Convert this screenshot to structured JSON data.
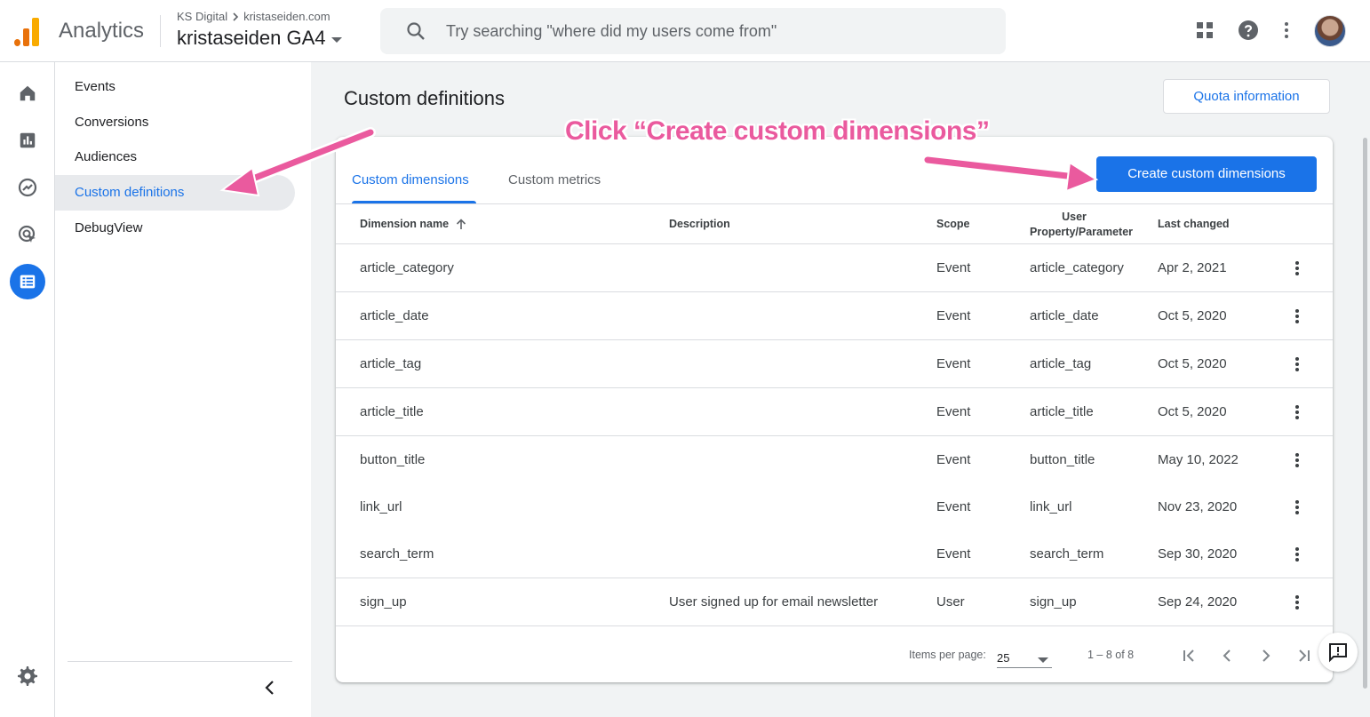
{
  "header": {
    "app_name": "Analytics",
    "account": "KS Digital",
    "site": "kristaseiden.com",
    "property": "kristaseiden GA4",
    "search_placeholder": "Try searching \"where did my users come from\""
  },
  "subnav": {
    "items": [
      {
        "label": "Events"
      },
      {
        "label": "Conversions"
      },
      {
        "label": "Audiences"
      },
      {
        "label": "Custom definitions",
        "active": true
      },
      {
        "label": "DebugView"
      }
    ]
  },
  "page": {
    "title": "Custom definitions",
    "quota_button": "Quota information"
  },
  "tabs": [
    {
      "label": "Custom dimensions",
      "active": true
    },
    {
      "label": "Custom metrics"
    }
  ],
  "create_button": "Create custom dimensions",
  "table": {
    "columns": {
      "name": "Dimension name",
      "description": "Description",
      "scope": "Scope",
      "param_line1": "User",
      "param_line2": "Property/Parameter",
      "changed": "Last changed"
    },
    "rows": [
      {
        "name": "article_category",
        "description": "",
        "scope": "Event",
        "param": "article_category",
        "changed": "Apr 2, 2021"
      },
      {
        "name": "article_date",
        "description": "",
        "scope": "Event",
        "param": "article_date",
        "changed": "Oct 5, 2020"
      },
      {
        "name": "article_tag",
        "description": "",
        "scope": "Event",
        "param": "article_tag",
        "changed": "Oct 5, 2020"
      },
      {
        "name": "article_title",
        "description": "",
        "scope": "Event",
        "param": "article_title",
        "changed": "Oct 5, 2020"
      },
      {
        "name": "button_title",
        "description": "",
        "scope": "Event",
        "param": "button_title",
        "changed": "May 10, 2022"
      },
      {
        "name": "link_url",
        "description": "",
        "scope": "Event",
        "param": "link_url",
        "changed": "Nov 23, 2020"
      },
      {
        "name": "search_term",
        "description": "",
        "scope": "Event",
        "param": "search_term",
        "changed": "Sep 30, 2020"
      },
      {
        "name": "sign_up",
        "description": "User signed up for email newsletter",
        "scope": "User",
        "param": "sign_up",
        "changed": "Sep 24, 2020"
      }
    ]
  },
  "pager": {
    "items_label": "Items per page:",
    "items_value": "25",
    "range": "1 – 8 of 8"
  },
  "annotation": {
    "text": "Click “Create custom dimensions”",
    "color": "#ea5a9e"
  },
  "colors": {
    "accent": "#1a73e8",
    "annotation": "#ea5a9e"
  }
}
